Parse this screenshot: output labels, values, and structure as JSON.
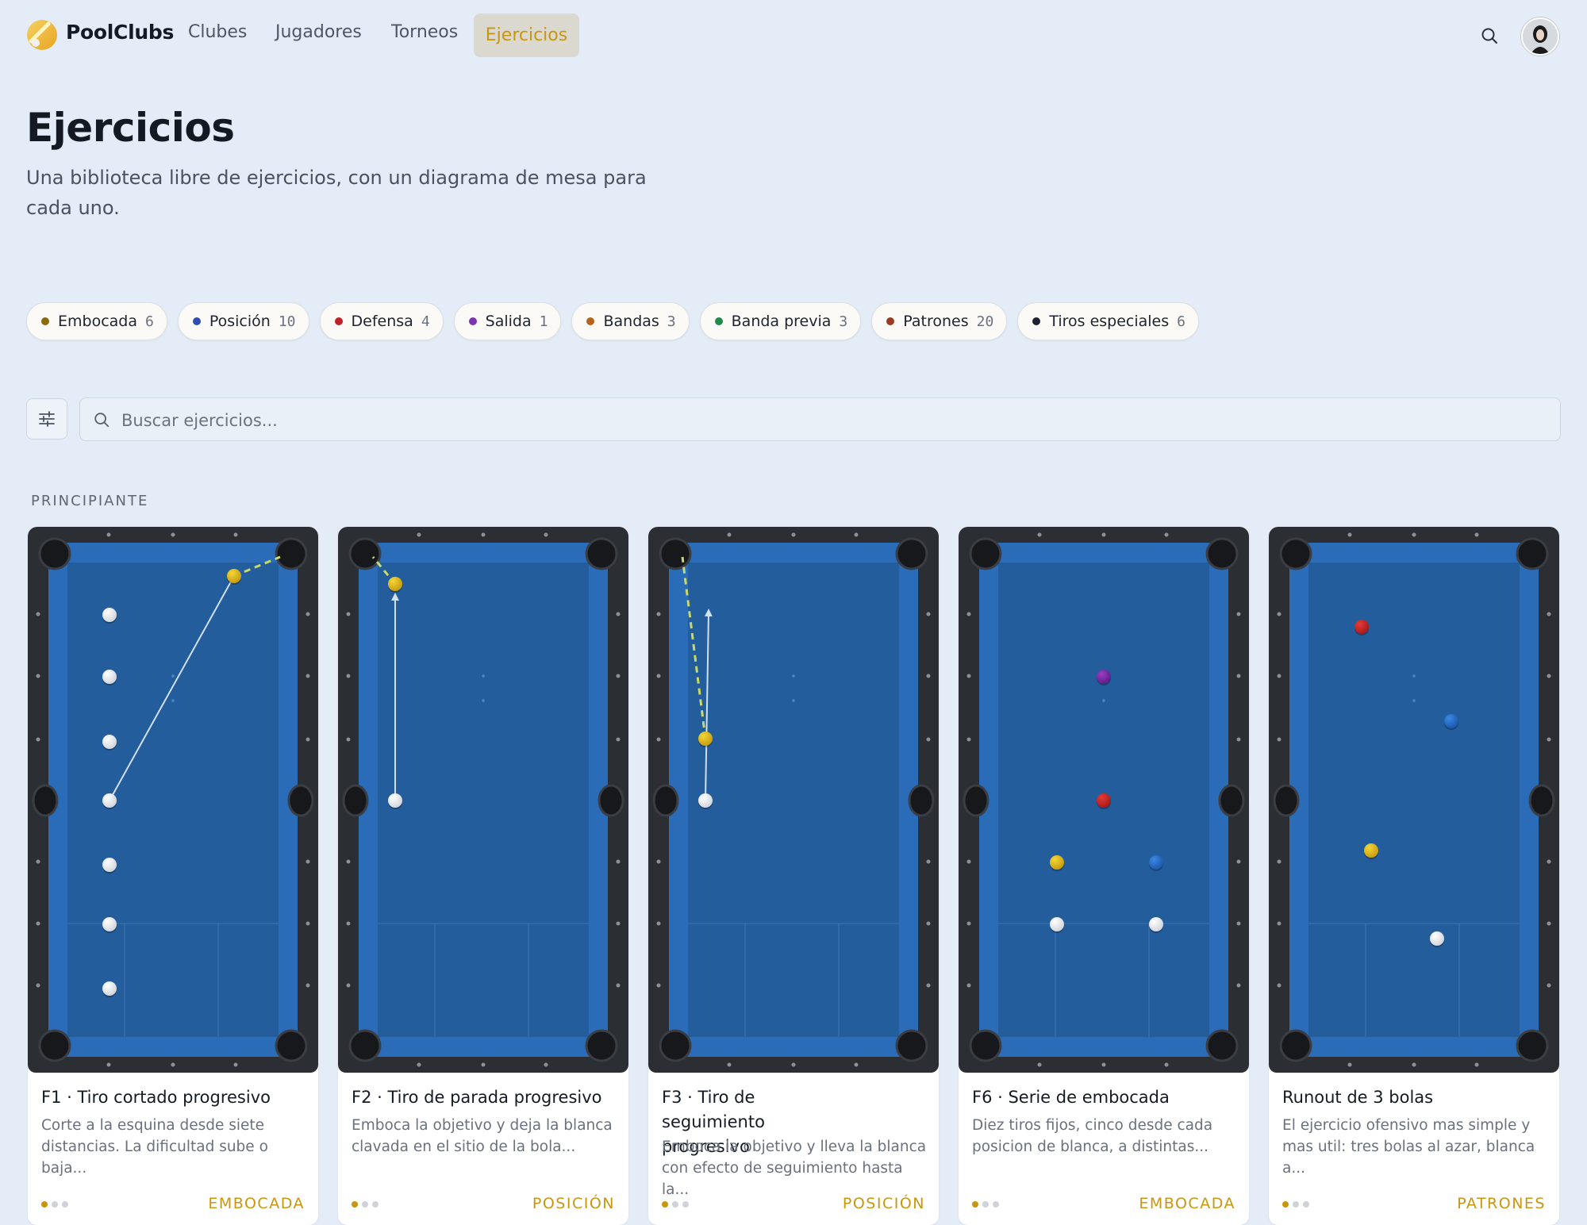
{
  "nav": {
    "brand": "PoolClubs",
    "links": [
      {
        "label": "Clubes"
      },
      {
        "label": "Jugadores"
      },
      {
        "label": "Torneos"
      },
      {
        "label": "Ejercicios",
        "active": true
      }
    ],
    "search_icon": "search-icon",
    "avatar": "user-avatar"
  },
  "header": {
    "title": "Ejercicios",
    "subtitle": "Una biblioteca libre de ejercicios, con un diagrama de mesa para cada uno."
  },
  "chips": [
    {
      "label": "Embocada",
      "count": "6",
      "color": "#8a6a0a"
    },
    {
      "label": "Posición",
      "count": "10",
      "color": "#2f4fb0"
    },
    {
      "label": "Defensa",
      "count": "4",
      "color": "#c0202a"
    },
    {
      "label": "Salida",
      "count": "1",
      "color": "#7a35b0"
    },
    {
      "label": "Bandas",
      "count": "3",
      "color": "#b86418"
    },
    {
      "label": "Banda previa",
      "count": "3",
      "color": "#1f8a4a"
    },
    {
      "label": "Patrones",
      "count": "20",
      "color": "#9a3a24"
    },
    {
      "label": "Tiros especiales",
      "count": "6",
      "color": "#1c2230"
    }
  ],
  "search": {
    "placeholder": "Buscar ejercicios..."
  },
  "section_label": "PRINCIPIANTE",
  "colors": {
    "accent": "#c9960e",
    "felt": "#235d9c",
    "cushion": "#2a6cb8",
    "frame": "#2b2e33"
  },
  "cards": [
    {
      "title": "F1 · Tiro cortado progresivo",
      "desc": "Corte a la esquina desde siete distancias. La dificultad sube o baja...",
      "category": "EMBOCADA",
      "level": 1
    },
    {
      "title": "F2 · Tiro de parada progresivo",
      "desc": "Emboca la objetivo y deja la blanca clavada en el sitio de la bola...",
      "category": "POSICIÓN",
      "level": 1
    },
    {
      "title": "F3 · Tiro de seguimiento progresivo",
      "desc": "Emboca la objetivo y lleva la blanca con efecto de seguimiento hasta la...",
      "category": "POSICIÓN",
      "level": 1
    },
    {
      "title": "F6 · Serie de embocada",
      "desc": "Diez tiros fijos, cinco desde cada posicion de blanca, a distintas...",
      "category": "EMBOCADA",
      "level": 1
    },
    {
      "title": "Runout de 3 bolas",
      "desc": "El ejercicio ofensivo mas simple y mas util: tres bolas al azar, blanca a...",
      "category": "PATRONES",
      "level": 1
    }
  ]
}
